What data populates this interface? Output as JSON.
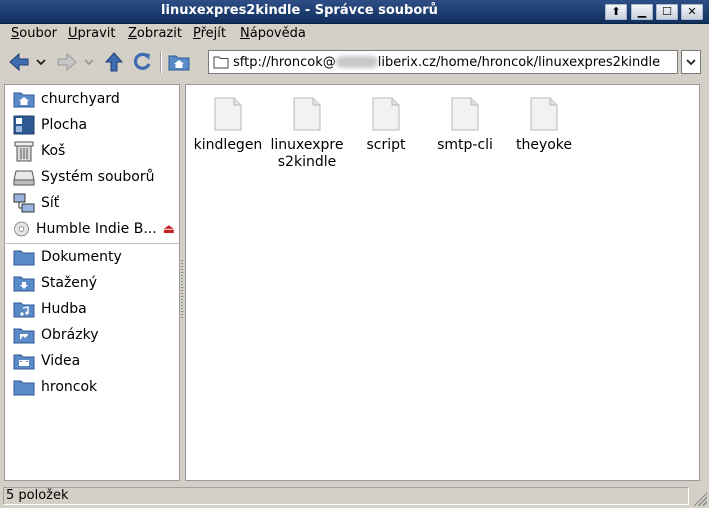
{
  "window": {
    "title": "linuxexpres2kindle - Správce souborů",
    "buttons": {
      "sticky": "⬆",
      "minimize": "▁",
      "maximize": "☐",
      "close": "✕"
    }
  },
  "menubar": [
    {
      "accel": "S",
      "rest": "oubor"
    },
    {
      "accel": "U",
      "rest": "pravit"
    },
    {
      "accel": "Z",
      "rest": "obrazit"
    },
    {
      "accel": "P",
      "rest": "řejít"
    },
    {
      "accel": "N",
      "rest": "ápověda"
    }
  ],
  "toolbar": {
    "icons": [
      "back-arrow-icon",
      "back-history-chevron-icon",
      "forward-arrow-icon",
      "forward-history-chevron-icon",
      "up-arrow-icon",
      "reload-icon",
      "home-folder-icon"
    ],
    "address_prefix": "sftp://hroncok@",
    "address_suffix": "liberix.cz/home/hroncok/linuxexpres2kindle",
    "address_dropdown": "⌄"
  },
  "sidebar": {
    "places": [
      {
        "label": "churchyard",
        "icon": "home-folder-icon"
      },
      {
        "label": "Plocha",
        "icon": "desktop-icon"
      },
      {
        "label": "Koš",
        "icon": "trash-icon"
      },
      {
        "label": "Systém souborů",
        "icon": "drive-icon"
      },
      {
        "label": "Síť",
        "icon": "network-icon"
      },
      {
        "label": "Humble Indie B...",
        "icon": "cdrom-icon",
        "eject": "⏏"
      }
    ],
    "bookmarks": [
      {
        "label": "Dokumenty",
        "icon": "folder-icon"
      },
      {
        "label": "Stažený",
        "icon": "download-folder-icon"
      },
      {
        "label": "Hudba",
        "icon": "music-folder-icon"
      },
      {
        "label": "Obrázky",
        "icon": "pictures-folder-icon"
      },
      {
        "label": "Videa",
        "icon": "video-folder-icon"
      },
      {
        "label": "hroncok",
        "icon": "folder-icon"
      }
    ]
  },
  "files": [
    {
      "name": "kindlegen"
    },
    {
      "name": "linuxexpres2kindle",
      "line1": "linuxexpre",
      "line2": "s2kindle"
    },
    {
      "name": "script"
    },
    {
      "name": "smtp-cli"
    },
    {
      "name": "theyoke"
    }
  ],
  "status": "5 položek",
  "colors": {
    "titlebar": "#1f3f76",
    "folder": "#4a7ab8",
    "eject": "#c82020"
  }
}
